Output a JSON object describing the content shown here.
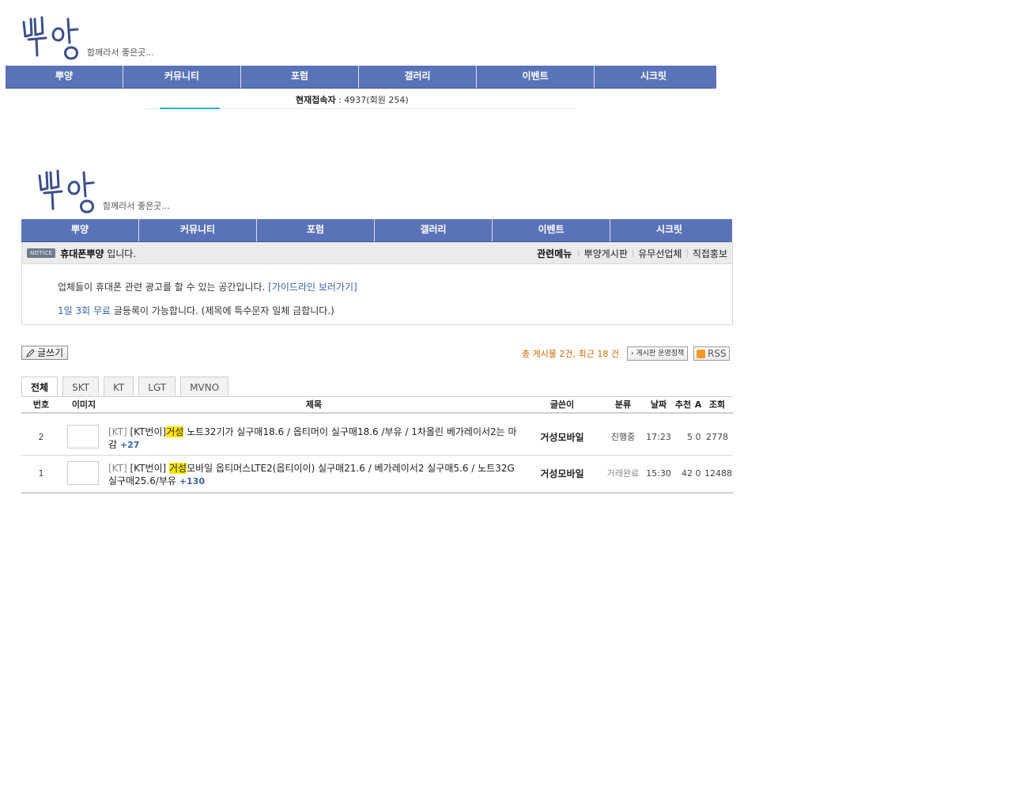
{
  "site": {
    "logo_text": "뿌양",
    "tagline": "함께라서 좋은곳..."
  },
  "nav": [
    "뿌양",
    "커뮤니티",
    "포럼",
    "갤러리",
    "이벤트",
    "시크릿"
  ],
  "visitors": {
    "label": "현재접속자",
    "value": " : 4937(회원 254)"
  },
  "notice": {
    "badge": "NOTICE",
    "board_name": "휴대폰뿌양",
    "suffix": " 입니다.",
    "related_title": "관련메뉴",
    "related_links": [
      "뿌양게시판",
      "유무선업체",
      "직접홍보"
    ],
    "line1_text": "업체들이 휴대폰 관련 광고를 할 수 있는 공간입니다. ",
    "line1_link": "[가이드라인 보러가기]",
    "line2_highlight": "1일 3회 무료",
    "line2_text": " 글등록이 가능합니다. (제목에 특수문자 일체 금합니다.)"
  },
  "board": {
    "write_label": "글쓰기",
    "stats": "총 게시물 2건, 최근 18 건",
    "policy_label": "› 게시판 운영정책",
    "rss_label": "RSS",
    "tabs": [
      "전체",
      "SKT",
      "KT",
      "LGT",
      "MVNO"
    ],
    "active_tab": "전체",
    "columns": {
      "num": "번호",
      "image": "이미지",
      "subject": "제목",
      "author": "글쓴이",
      "category": "분류",
      "date": "날짜",
      "recommend": "추천",
      "a": "A",
      "views": "조회"
    },
    "rows": [
      {
        "num": "2",
        "cat": "[KT]",
        "pre": "[KT번이]",
        "hl": "거성",
        "post": " 노트32기가 실구매18.6 / 옵티머이 실구매18.6 /부유 / 1차올린 베가레이서2는 마감",
        "comments": "+27",
        "author": "거성모바일",
        "category": "진행중",
        "date": "17:23",
        "recommend": "5",
        "a": "0",
        "views": "2778"
      },
      {
        "num": "1",
        "cat": "[KT]",
        "pre": "[KT번이] ",
        "hl": "거성",
        "post": "모바일 옵티머스LTE2(옵티이이) 실구매21.6 / 베가레이서2 실구매5.6 / 노트32G 실구매25.6/부유",
        "comments": "+130",
        "author": "거성모바일",
        "category": "거래완료",
        "date": "15:30",
        "recommend": "42",
        "a": "0",
        "views": "12488"
      }
    ]
  },
  "colors": {
    "nav_bg": "#5a73b8",
    "highlight": "#ffe600",
    "stats_orange": "#cc6600",
    "link_blue": "#3a64a8"
  }
}
